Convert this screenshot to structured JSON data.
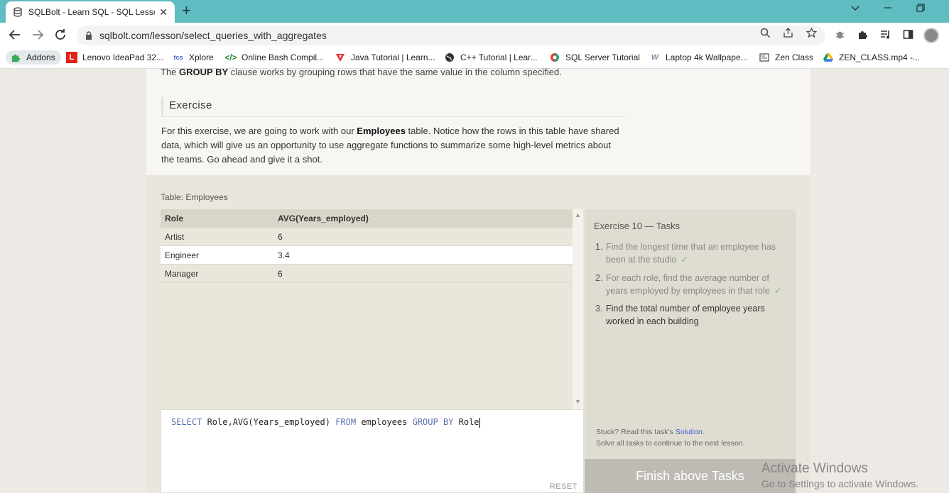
{
  "browser": {
    "tab_title": "SQLBolt - Learn SQL - SQL Lesso",
    "tab_close": "✕",
    "new_tab": "+",
    "url": "sqlbolt.com/lesson/select_queries_with_aggregates",
    "bookmarks": [
      {
        "label": "Addons",
        "icon": "puzzle-icon"
      },
      {
        "label": "Lenovo IdeaPad 32...",
        "icon": "lenovo-icon"
      },
      {
        "label": "Xplore",
        "icon": "tcs-icon"
      },
      {
        "label": "Online Bash Compil...",
        "icon": "code-icon"
      },
      {
        "label": "Java Tutorial | Learn...",
        "icon": "java-icon"
      },
      {
        "label": "C++ Tutorial | Lear...",
        "icon": "globe-icon"
      },
      {
        "label": "SQL Server Tutorial",
        "icon": "sql-icon"
      },
      {
        "label": "Laptop 4k Wallpape...",
        "icon": "wallpaper-icon"
      },
      {
        "label": "Zen Class",
        "icon": "zen-icon"
      },
      {
        "label": "ZEN_CLASS.mp4 -...",
        "icon": "drive-icon"
      }
    ]
  },
  "lesson": {
    "intro_pre": "The ",
    "intro_bold": "GROUP BY",
    "intro_post": " clause works by grouping rows that have the same value in the column specified.",
    "exercise_heading": "Exercise",
    "exercise_p1": "For this exercise, we are going to work with our ",
    "exercise_bold": "Employees",
    "exercise_p2": " table. Notice how the rows in this table have shared data, which will give us an opportunity to use aggregate functions to summarize some high-level metrics about the teams. Go ahead and give it a shot."
  },
  "result": {
    "caption": "Table: Employees",
    "headers": [
      "Role",
      "AVG(Years_employed)"
    ],
    "rows": [
      [
        "Artist",
        "6"
      ],
      [
        "Engineer",
        "3.4"
      ],
      [
        "Manager",
        "6"
      ]
    ]
  },
  "editor": {
    "kw_select": "SELECT",
    "part1": " Role,AVG(Years_employed) ",
    "kw_from": "FROM",
    "part2": " employees ",
    "kw_group": "GROUP BY",
    "part3": " Role",
    "reset": "RESET"
  },
  "tasks": {
    "title": "Exercise 10 — Tasks",
    "items": [
      {
        "num": "1.",
        "text": "Find the longest time that an employee has been at the studio",
        "done": "✓"
      },
      {
        "num": "2.",
        "text": "For each role, find the average number of years employed by employees in that role",
        "done": "✓"
      },
      {
        "num": "3.",
        "text": "Find the total number of employee years worked in each building",
        "done": ""
      }
    ],
    "stuck_pre": "Stuck? Read this task's ",
    "stuck_link": "Solution",
    "stuck_post": ".",
    "solve_all": "Solve all tasks to continue to the next lesson.",
    "finish": "Finish above Tasks"
  },
  "watermark": {
    "line1": "Activate Windows",
    "line2": "Go to Settings to activate Windows."
  }
}
